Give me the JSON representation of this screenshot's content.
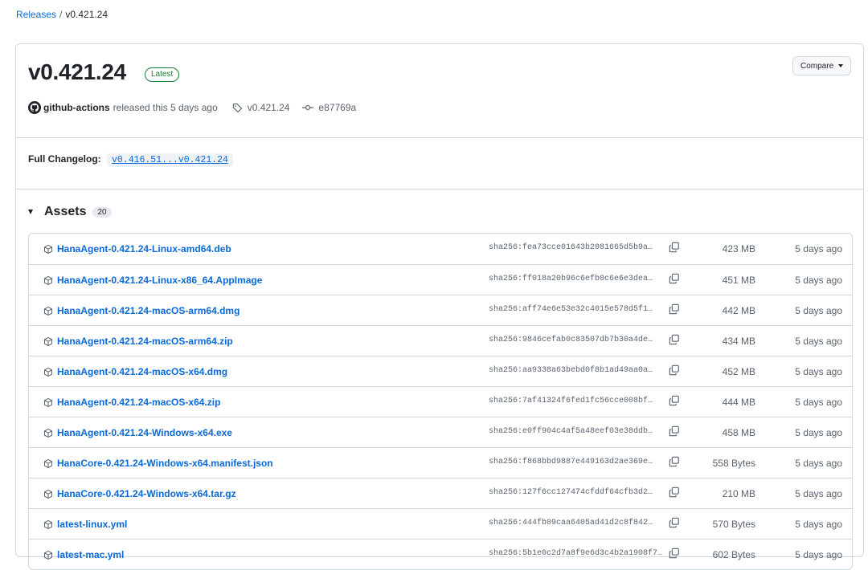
{
  "breadcrumb": {
    "parent": "Releases",
    "separator": "/",
    "current": "v0.421.24"
  },
  "release": {
    "title": "v0.421.24",
    "badge": "Latest",
    "compare_label": "Compare",
    "author": "github-actions",
    "released_text": "released this 5 days ago",
    "tag": "v0.421.24",
    "commit": "e87769a",
    "changelog_label": "Full Changelog:",
    "changelog_link": "v0.416.51...v0.421.24"
  },
  "assets": {
    "title": "Assets",
    "count": "20",
    "items": [
      {
        "name": "HanaAgent-0.421.24-Linux-amd64.deb",
        "sha": "sha256:fea73cce01643b2081665d5b9a…",
        "size": "423 MB",
        "date": "5 days ago"
      },
      {
        "name": "HanaAgent-0.421.24-Linux-x86_64.AppImage",
        "sha": "sha256:ff018a20b96c6efb0c6e6e3dea…",
        "size": "451 MB",
        "date": "5 days ago"
      },
      {
        "name": "HanaAgent-0.421.24-macOS-arm64.dmg",
        "sha": "sha256:aff74e6e53e32c4015e578d5f1…",
        "size": "442 MB",
        "date": "5 days ago"
      },
      {
        "name": "HanaAgent-0.421.24-macOS-arm64.zip",
        "sha": "sha256:9846cefab0c83507db7b30a4de…",
        "size": "434 MB",
        "date": "5 days ago"
      },
      {
        "name": "HanaAgent-0.421.24-macOS-x64.dmg",
        "sha": "sha256:aa9338a63bebd0f8b1ad49aa0a…",
        "size": "452 MB",
        "date": "5 days ago"
      },
      {
        "name": "HanaAgent-0.421.24-macOS-x64.zip",
        "sha": "sha256:7af41324f6fed1fc56cce008bf…",
        "size": "444 MB",
        "date": "5 days ago"
      },
      {
        "name": "HanaAgent-0.421.24-Windows-x64.exe",
        "sha": "sha256:e0ff904c4af5a48eef03e38ddb…",
        "size": "458 MB",
        "date": "5 days ago"
      },
      {
        "name": "HanaCore-0.421.24-Windows-x64.manifest.json",
        "sha": "sha256:f868bbd9887e449163d2ae369e…",
        "size": "558 Bytes",
        "date": "5 days ago"
      },
      {
        "name": "HanaCore-0.421.24-Windows-x64.tar.gz",
        "sha": "sha256:127f6cc127474cfddf64cfb3d2…",
        "size": "210 MB",
        "date": "5 days ago"
      },
      {
        "name": "latest-linux.yml",
        "sha": "sha256:444fb09caa6405ad41d2c8f842…",
        "size": "570 Bytes",
        "date": "5 days ago"
      },
      {
        "name": "latest-mac.yml",
        "sha": "sha256:5b1e0c2d7a8f9e6d3c4b2a1908f7…",
        "size": "602 Bytes",
        "date": "5 days ago"
      }
    ]
  },
  "icons": {
    "avatar": "github-mark-icon",
    "tag": "tag-icon",
    "commit": "git-commit-icon",
    "package": "package-icon",
    "copy": "copy-icon",
    "caret": "caret-down-icon",
    "disclosure": "triangle-down-icon"
  },
  "colors": {
    "link": "#0969da",
    "latest": "#1a7f37",
    "border": "#d1d9e0",
    "muted": "#59636e"
  }
}
